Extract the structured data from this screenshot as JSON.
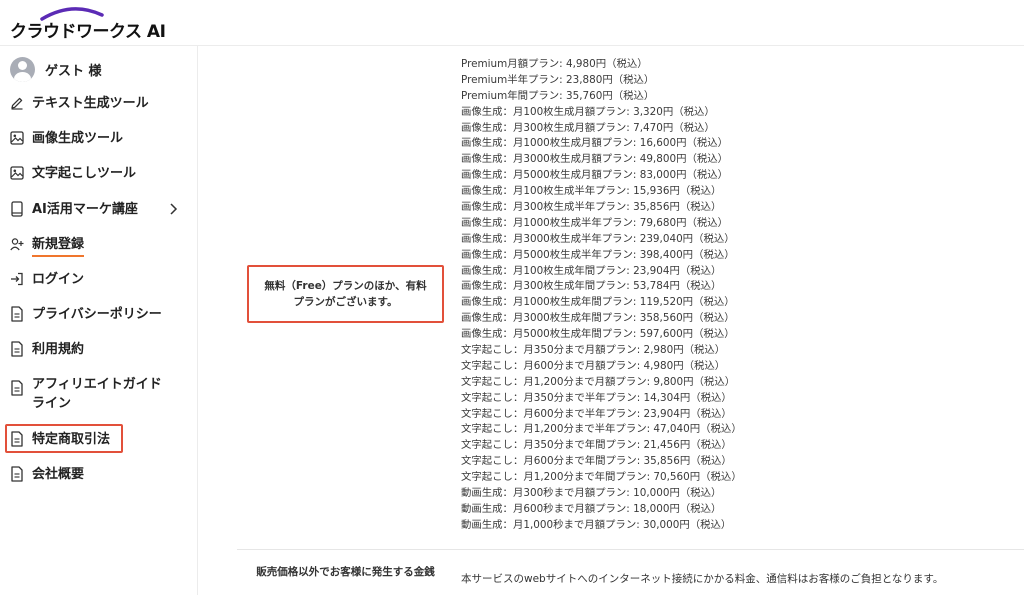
{
  "header": {
    "logo_text": "クラウドワークス AI"
  },
  "sidebar": {
    "user_name": "ゲスト 様",
    "items": [
      {
        "label": "テキスト生成ツール",
        "icon": "pencil-icon"
      },
      {
        "label": "画像生成ツール",
        "icon": "image-icon"
      },
      {
        "label": "文字起こしツール",
        "icon": "image-icon"
      },
      {
        "label": "AI活用マーケ講座",
        "icon": "book-icon"
      },
      {
        "label": "新規登録",
        "icon": "user-plus-icon"
      },
      {
        "label": "ログイン",
        "icon": "login-icon"
      },
      {
        "label": "プライバシーポリシー",
        "icon": "document-icon"
      },
      {
        "label": "利用規約",
        "icon": "document-icon"
      },
      {
        "label": "アフィリエイトガイドライン",
        "icon": "document-icon"
      },
      {
        "label": "特定商取引法",
        "icon": "document-icon"
      },
      {
        "label": "会社概要",
        "icon": "document-icon"
      }
    ]
  },
  "main": {
    "price_label": "無料（Free）プランのほか、有料プランがございます。",
    "plans": [
      "Premium月額プラン: 4,980円（税込）",
      "Premium半年プラン: 23,880円（税込）",
      "Premium年間プラン: 35,760円（税込）",
      "画像生成：月100枚生成月額プラン: 3,320円（税込）",
      "画像生成：月300枚生成月額プラン: 7,470円（税込）",
      "画像生成：月1000枚生成月額プラン: 16,600円（税込）",
      "画像生成：月3000枚生成月額プラン: 49,800円（税込）",
      "画像生成：月5000枚生成月額プラン: 83,000円（税込）",
      "画像生成：月100枚生成半年プラン: 15,936円（税込）",
      "画像生成：月300枚生成半年プラン: 35,856円（税込）",
      "画像生成：月1000枚生成半年プラン: 79,680円（税込）",
      "画像生成：月3000枚生成半年プラン: 239,040円（税込）",
      "画像生成：月5000枚生成半年プラン: 398,400円（税込）",
      "画像生成：月100枚生成年間プラン: 23,904円（税込）",
      "画像生成：月300枚生成年間プラン: 53,784円（税込）",
      "画像生成：月1000枚生成年間プラン: 119,520円（税込）",
      "画像生成：月3000枚生成年間プラン: 358,560円（税込）",
      "画像生成：月5000枚生成年間プラン: 597,600円（税込）",
      "文字起こし：月350分まで月額プラン: 2,980円（税込）",
      "文字起こし：月600分まで月額プラン: 4,980円（税込）",
      "文字起こし：月1,200分まで月額プラン: 9,800円（税込）",
      "文字起こし：月350分まで半年プラン: 14,304円（税込）",
      "文字起こし：月600分まで半年プラン: 23,904円（税込）",
      "文字起こし：月1,200分まで半年プラン: 47,040円（税込）",
      "文字起こし：月350分まで年間プラン: 21,456円（税込）",
      "文字起こし：月600分まで年間プラン: 35,856円（税込）",
      "文字起こし：月1,200分まで年間プラン: 70,560円（税込）",
      "動画生成：月300秒まで月額プラン: 10,000円（税込）",
      "動画生成：月600秒まで月額プラン: 18,000円（税込）",
      "動画生成：月1,000秒まで月額プラン: 30,000円（税込）"
    ],
    "row2_label": "販売価格以外でお客様に発生する金銭",
    "row2_value": "本サービスのwebサイトへのインターネット接続にかかる料金、通信料はお客様のご負担となります。"
  },
  "colors": {
    "accent_orange": "#f0762d",
    "highlight_red": "#e2503a",
    "logo_purple": "#5b2bb5"
  }
}
